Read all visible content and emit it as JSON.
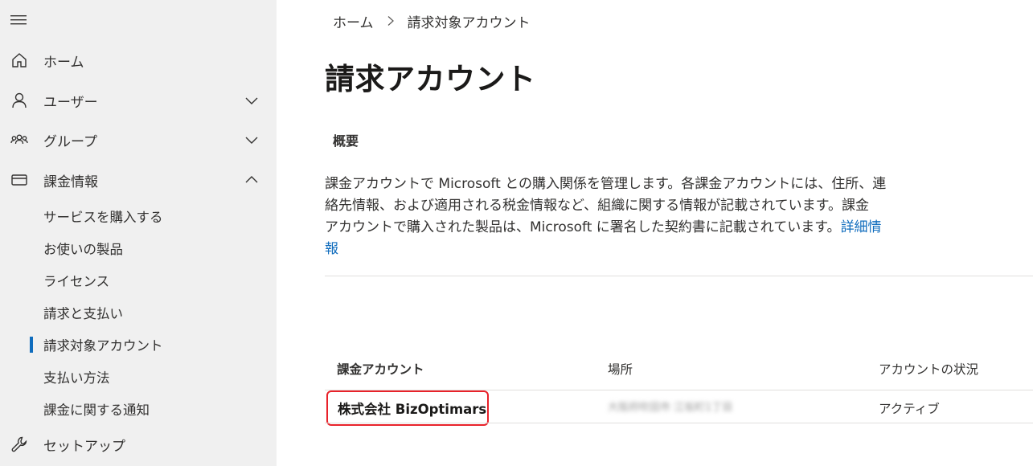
{
  "sidebar": {
    "items": [
      {
        "label": "ホーム"
      },
      {
        "label": "ユーザー"
      },
      {
        "label": "グループ"
      },
      {
        "label": "課金情報"
      },
      {
        "label": "セットアップ"
      }
    ],
    "billing_subitems": [
      {
        "label": "サービスを購入する"
      },
      {
        "label": "お使いの製品"
      },
      {
        "label": "ライセンス"
      },
      {
        "label": "請求と支払い"
      },
      {
        "label": "請求対象アカウント"
      },
      {
        "label": "支払い方法"
      },
      {
        "label": "課金に関する通知"
      }
    ],
    "active_subitem": "請求対象アカウント"
  },
  "breadcrumb": {
    "home": "ホーム",
    "current": "請求対象アカウント"
  },
  "page": {
    "title": "請求アカウント",
    "tab": "概要",
    "description_line1": "課金アカウントで Microsoft との購入関係を管理します。各課金アカウントには、住所、連",
    "description_line2": "絡先情報、および適用される税金情報など、組織に関する情報が記載されています。課金",
    "description_line3": "アカウントで購入された製品は、Microsoft に署名した契約書に記載されています。",
    "learn_more_part1": "詳細情",
    "learn_more_part2": "報"
  },
  "table": {
    "headers": [
      "課金アカウント",
      "場所",
      "アカウントの状況"
    ],
    "rows": [
      {
        "account": "株式会社 BizOptimars",
        "location": "大阪府吹田市 江坂町1丁目",
        "status": "アクティブ"
      }
    ]
  },
  "colors": {
    "sidebar_bg": "#f0f0f0",
    "link": "#0f6cbd",
    "highlight_border": "#e8222a",
    "active_indicator": "#0f6cbd"
  }
}
